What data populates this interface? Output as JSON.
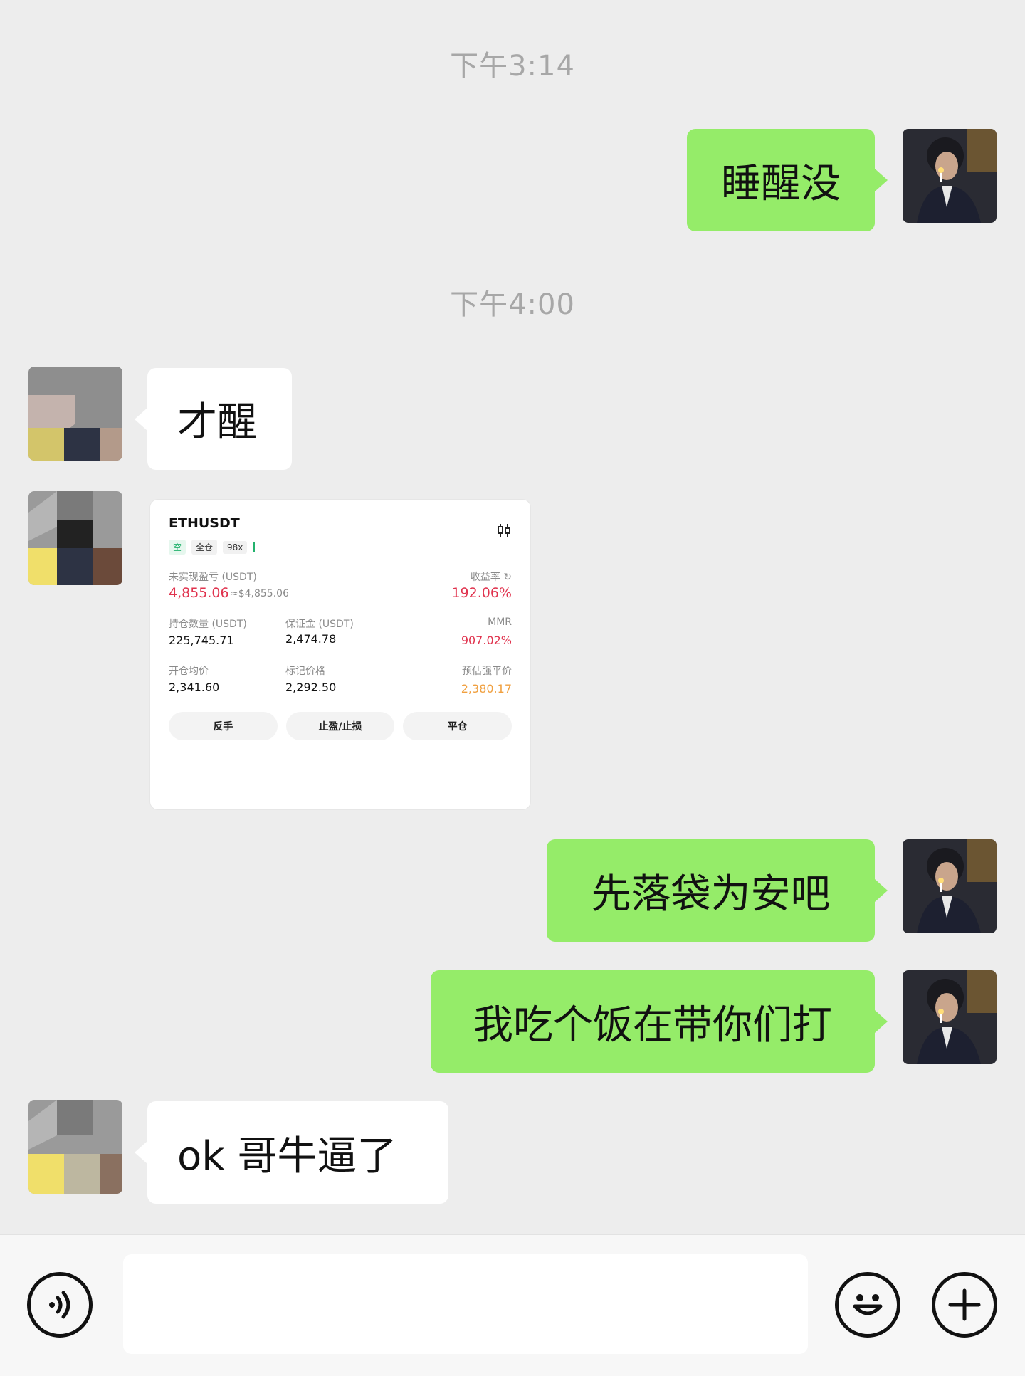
{
  "messages": {
    "ts1": "下午3:14",
    "ts2": "下午4:00",
    "m1": "睡醒没",
    "m2": "才醒",
    "m4": "先落袋为安吧",
    "m5": "我吃个饭在带你们打",
    "m6": "ok  哥牛逼了"
  },
  "card": {
    "symbol": "ETHUSDT",
    "tag_side": "空",
    "tag_mode": "全仓",
    "tag_leverage": "98x",
    "pnl_label": "未实现盈亏 (USDT)",
    "pnl_value": "4,855.06",
    "pnl_usd": "≈$4,855.06",
    "roe_label": "收益率",
    "roe_value": "192.06%",
    "size_label": "持仓数量 (USDT)",
    "size_value": "225,745.71",
    "margin_label": "保证金 (USDT)",
    "margin_value": "2,474.78",
    "mmr_label": "MMR",
    "mmr_value": "907.02%",
    "entry_label": "开仓均价",
    "entry_value": "2,341.60",
    "mark_label": "标记价格",
    "mark_value": "2,292.50",
    "liq_label": "预估强平价",
    "liq_value": "2,380.17",
    "btn_reverse": "反手",
    "btn_tpsl": "止盈/止损",
    "btn_close": "平仓"
  },
  "colors": {
    "my_bubble": "#95ec69",
    "their_bubble": "#ffffff",
    "background": "#ededed",
    "profit_red": "#e0334e",
    "liq_orange": "#f0a040"
  },
  "icons": {
    "voice": "voice-icon",
    "emoji": "emoji-icon",
    "plus": "plus-icon",
    "chart": "candlestick-icon"
  }
}
